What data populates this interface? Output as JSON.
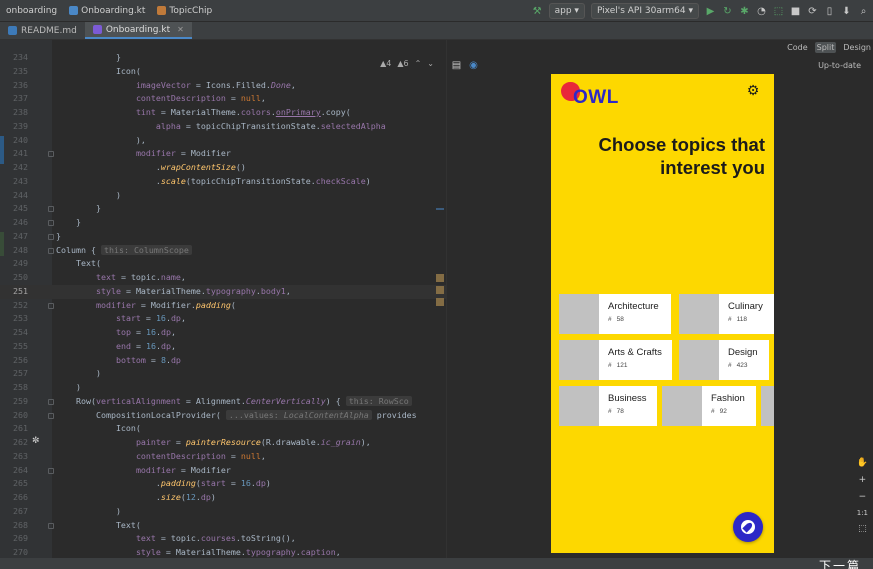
{
  "nav": {
    "crumbs": [
      "onboarding",
      "Onboarding.kt",
      "TopicChip"
    ],
    "run_config": "app",
    "device": "Pixel 3 API 30 arm64",
    "device_label": "Pixel's API 30arm64"
  },
  "tabs": [
    {
      "label": "README.md",
      "active": false
    },
    {
      "label": "Onboarding.kt",
      "active": true
    }
  ],
  "editor": {
    "inspection": {
      "warnings": "4",
      "weak": "6"
    },
    "lines": [
      {
        "n": "234"
      },
      {
        "n": "235"
      },
      {
        "n": "236"
      },
      {
        "n": "237"
      },
      {
        "n": "238"
      },
      {
        "n": "239"
      },
      {
        "n": "240"
      },
      {
        "n": "241"
      },
      {
        "n": "242"
      },
      {
        "n": "243"
      },
      {
        "n": "244"
      },
      {
        "n": "245"
      },
      {
        "n": "246"
      },
      {
        "n": "247"
      },
      {
        "n": "248"
      },
      {
        "n": "249"
      },
      {
        "n": "250"
      },
      {
        "n": "251"
      },
      {
        "n": "252"
      },
      {
        "n": "253"
      },
      {
        "n": "254"
      },
      {
        "n": "255"
      },
      {
        "n": "256"
      },
      {
        "n": "257"
      },
      {
        "n": "258"
      },
      {
        "n": "259"
      },
      {
        "n": "260"
      },
      {
        "n": "261"
      },
      {
        "n": "262"
      },
      {
        "n": "263"
      },
      {
        "n": "264"
      },
      {
        "n": "265"
      },
      {
        "n": "266"
      },
      {
        "n": "267"
      },
      {
        "n": "268"
      },
      {
        "n": "269"
      },
      {
        "n": "270"
      }
    ],
    "hints": {
      "column_scope": "this: ColumnScope",
      "row_scope": "this: RowSco",
      "values": "...values: ",
      "local_content_alpha": "LocalContentAlpha",
      "provides": " provides"
    }
  },
  "preview": {
    "view_modes": [
      "Code",
      "Split",
      "Design"
    ],
    "status": "Up-to-date",
    "app": {
      "logo_text": "OWL",
      "headline_1": "Choose topics that",
      "headline_2": "interest you",
      "topics": [
        {
          "name": "Architecture",
          "count": "58"
        },
        {
          "name": "Culinary",
          "count": "118"
        },
        {
          "name": "Arts & Crafts",
          "count": "121"
        },
        {
          "name": "Design",
          "count": "423"
        },
        {
          "name": "Business",
          "count": "78"
        },
        {
          "name": "Fashion",
          "count": "92"
        }
      ],
      "count_prefix": "#"
    },
    "zoom_label": "1:1"
  },
  "subtitle": "下一篇",
  "colors": {
    "brand_yellow": "#fdd800",
    "brand_blue": "#2d28c7",
    "brand_red": "#e8283a"
  }
}
